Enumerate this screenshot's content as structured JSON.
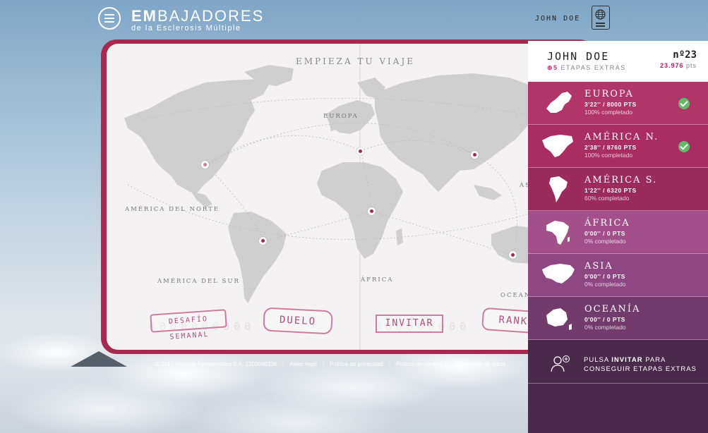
{
  "header": {
    "logo_bold": "EM",
    "logo_rest": "BAJADORES",
    "logo_sub": "de la Esclerosis Múltiple",
    "user_name": "JOHN DOE"
  },
  "map": {
    "title": "EMPIEZA TU VIAJE",
    "labels": {
      "europa": "EUROPA",
      "america_norte": "AMÉRICA DEL NORTE",
      "america_sur": "AMÉRICA DEL SUR",
      "africa": "ÁFRICA",
      "asia": "ASIA",
      "oceania": "OCEANÍA"
    }
  },
  "actions": {
    "desafio": "DESAFÍO SEMANAL",
    "duelo": "DUELO",
    "invitar": "INVITAR",
    "ranking": "RANKING"
  },
  "panel": {
    "name": "JOHN DOE",
    "extra_plus": "⊕5",
    "extra_text": " ETAPAS EXTRAS",
    "rank": "nº23",
    "points": "23.976",
    "points_unit": "pts",
    "regions": [
      {
        "name": "EUROPA",
        "score": "3'22'' / 8000 PTS",
        "pct": "100% completado",
        "done": true,
        "color": "#b23569"
      },
      {
        "name": "AMÉRICA N.",
        "score": "2'38'' / 8760 PTS",
        "pct": "100% completado",
        "done": true,
        "color": "#a92d62"
      },
      {
        "name": "AMÉRICA S.",
        "score": "1'22'' / 6320 PTS",
        "pct": "60% completado",
        "done": false,
        "color": "#9b2a5d"
      },
      {
        "name": "ÁFRICA",
        "score": "0'00'' / 0 PTS",
        "pct": "0% completado",
        "done": false,
        "color": "#a24f8a"
      },
      {
        "name": "ASIA",
        "score": "0'00'' / 0 PTS",
        "pct": "0% completado",
        "done": false,
        "color": "#8f4783"
      },
      {
        "name": "OCEANÍA",
        "score": "0'00'' / 0 PTS",
        "pct": "0% completado",
        "done": false,
        "color": "#733a6c"
      }
    ],
    "invite_pre": "PULSA ",
    "invite_bold": "INVITAR",
    "invite_post": " PARA CONSEGUIR ETAPAS EXTRAS"
  },
  "footer": {
    "copyright": "© 2017 Novartis Farmacéutica S.A. 1702040336",
    "links": [
      "Aviso legal",
      "Política de privacidad",
      "Política de cookies",
      "Protección de datos"
    ]
  },
  "colors": {
    "brand": "#a8294f",
    "check": "#62b968"
  }
}
